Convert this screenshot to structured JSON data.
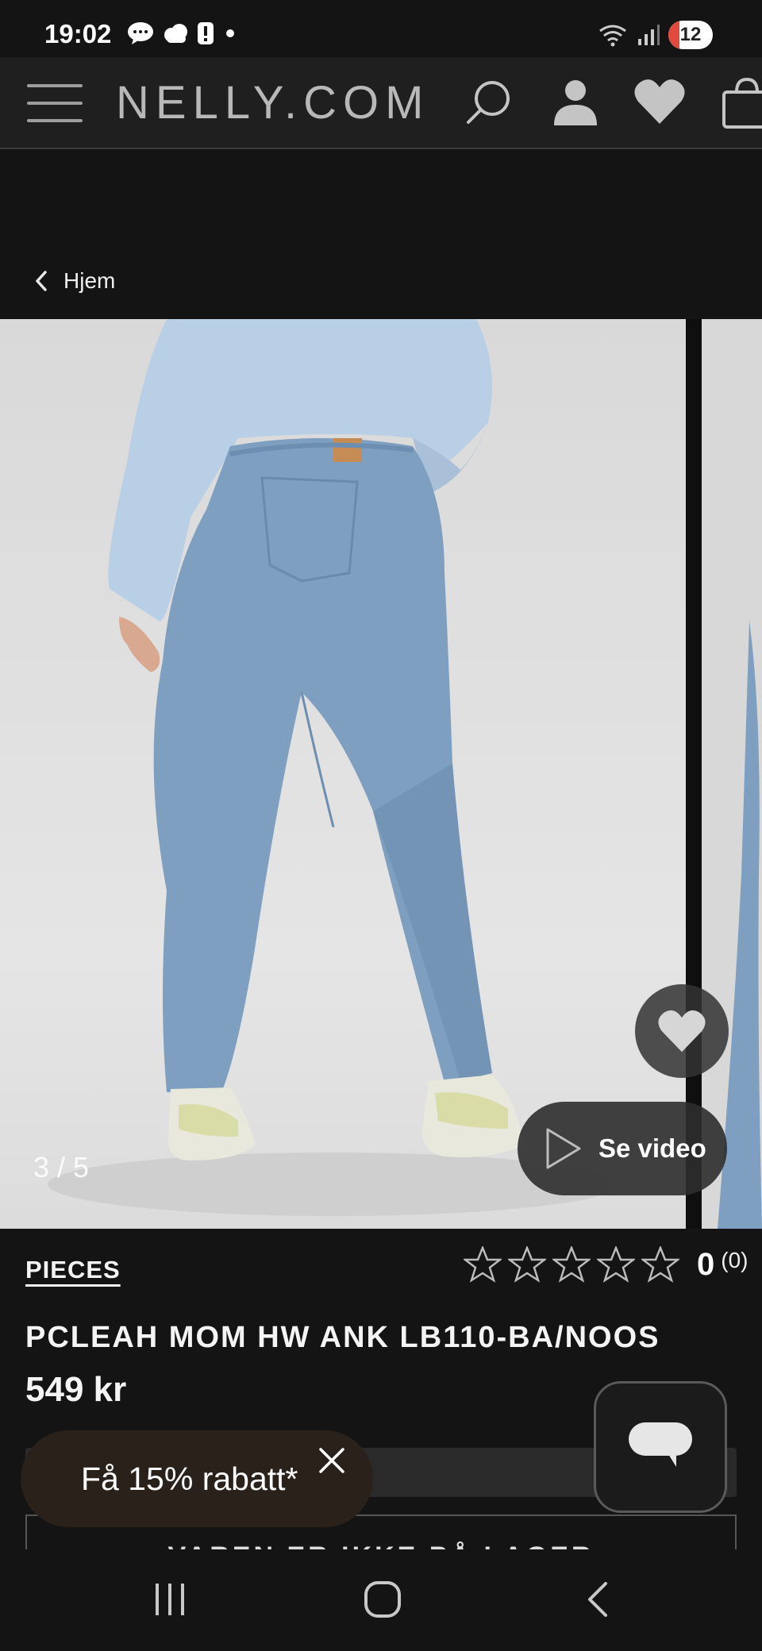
{
  "status_bar": {
    "time": "19:02",
    "battery": "12",
    "icons_left": [
      "chat-bubble-icon",
      "cloud-icon",
      "alert-icon",
      "dot-icon"
    ],
    "icons_right": [
      "wifi-icon",
      "signal-icon"
    ]
  },
  "header": {
    "brand": "NELLY.COM",
    "icons": [
      "menu-icon",
      "search-icon",
      "account-icon",
      "heart-icon",
      "bag-icon"
    ]
  },
  "breadcrumb": {
    "back_label": "Hjem"
  },
  "gallery": {
    "counter": "3 / 5",
    "video_label": "Se video"
  },
  "product": {
    "brand": "PIECES",
    "title": "PCLEAH MOM HW ANK LB110-BA/NOOS",
    "price": "549 kr",
    "rating": {
      "score": "0",
      "count": "(0)",
      "stars_filled": 0,
      "stars_total": 5
    },
    "stock_label": "VAREN ER IKKE PÅ LAGER"
  },
  "promo": {
    "discount_label": "Få 15% rabatt*"
  },
  "colors": {
    "background": "#141414",
    "header": "#1f1f1f",
    "accent_battery": "#e24a3b"
  }
}
